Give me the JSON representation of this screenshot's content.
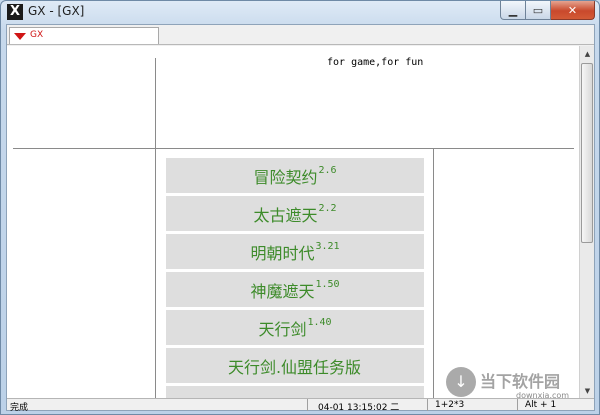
{
  "window": {
    "title": "GX - [GX]",
    "icon": "x-app-icon"
  },
  "tab": {
    "label": "GX",
    "icon": "dropdown-arrow-icon"
  },
  "content": {
    "tagline": "for game,for fun",
    "games": [
      {
        "name": "冒险契约",
        "version": "2.6"
      },
      {
        "name": "太古遮天",
        "version": "2.2"
      },
      {
        "name": "明朝时代",
        "version": "3.21"
      },
      {
        "name": "神魔遮天",
        "version": "1.50"
      },
      {
        "name": "天行剑",
        "version": "1.40"
      },
      {
        "name": "天行剑.仙盟任务版",
        "version": ""
      }
    ]
  },
  "statusbar": {
    "status": "完成",
    "datetime": "04-01 13:15:02 二",
    "formula": "1+2*3",
    "shortcut": "Alt + 1"
  },
  "watermark": {
    "name": "当下软件园",
    "url": "downxia.com"
  },
  "colors": {
    "game_text": "#3d8b2a",
    "tab_accent": "#d01515"
  }
}
